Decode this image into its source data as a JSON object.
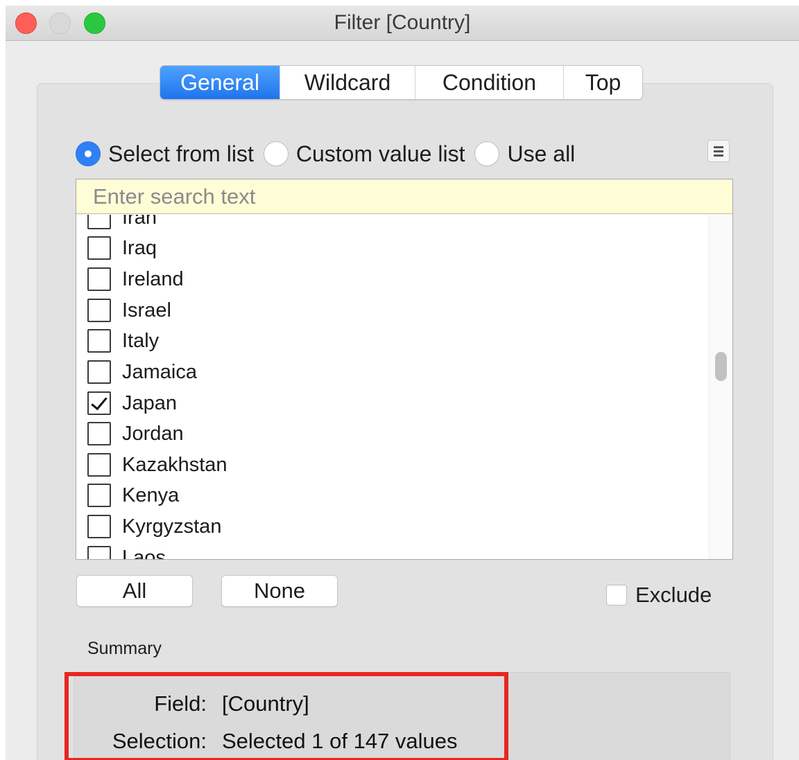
{
  "window": {
    "title": "Filter [Country]"
  },
  "tabs": [
    {
      "label": "General",
      "active": true
    },
    {
      "label": "Wildcard",
      "active": false
    },
    {
      "label": "Condition",
      "active": false
    },
    {
      "label": "Top",
      "active": false
    }
  ],
  "mode": {
    "options": [
      {
        "label": "Select from list",
        "selected": true
      },
      {
        "label": "Custom value list",
        "selected": false
      },
      {
        "label": "Use all",
        "selected": false
      }
    ]
  },
  "menu_icon": "list-menu-icon",
  "search": {
    "placeholder": "Enter search text",
    "value": ""
  },
  "items": [
    {
      "label": "Iran",
      "checked": false
    },
    {
      "label": "Iraq",
      "checked": false
    },
    {
      "label": "Ireland",
      "checked": false
    },
    {
      "label": "Israel",
      "checked": false
    },
    {
      "label": "Italy",
      "checked": false
    },
    {
      "label": "Jamaica",
      "checked": false
    },
    {
      "label": "Japan",
      "checked": true
    },
    {
      "label": "Jordan",
      "checked": false
    },
    {
      "label": "Kazakhstan",
      "checked": false
    },
    {
      "label": "Kenya",
      "checked": false
    },
    {
      "label": "Kyrgyzstan",
      "checked": false
    },
    {
      "label": "Laos",
      "checked": false
    }
  ],
  "buttons": {
    "all": "All",
    "none": "None"
  },
  "exclude": {
    "label": "Exclude",
    "checked": false
  },
  "summary": {
    "title": "Summary",
    "field_label": "Field:",
    "field_value": "[Country]",
    "selection_label": "Selection:",
    "selection_value": "Selected 1 of 147 values"
  },
  "colors": {
    "accent": "#2f80f5",
    "highlight": "#e8261f",
    "search_bg": "#fefdd6"
  }
}
